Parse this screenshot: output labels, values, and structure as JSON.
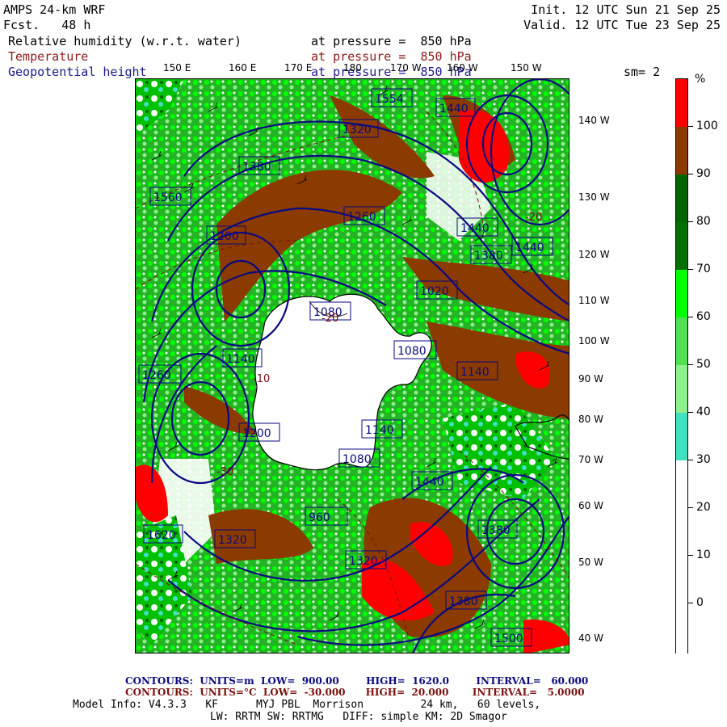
{
  "header": {
    "model": "AMPS 24-km WRF",
    "fcst": "Fcst.   48 h",
    "init": "Init. 12 UTC Sun 21 Sep 25",
    "valid": "Valid. 12 UTC Tue 23 Sep 25"
  },
  "fields": [
    {
      "name": "Relative humidity (w.r.t. water)",
      "pressure": "at pressure =  850 hPa",
      "color": "#000000"
    },
    {
      "name": "Temperature",
      "pressure": "at pressure =  850 hPa",
      "color": "#8b1a1a"
    },
    {
      "name": "Geopotential height",
      "pressure": "at pressure =  850 hPa",
      "color": "#1a1a8b"
    }
  ],
  "smoothing": "sm= 2",
  "top_lon_labels": [
    "150 E",
    "160 E",
    "170 E",
    "180",
    "170 W",
    "160 W",
    "150 W"
  ],
  "right_lon_labels": [
    "140 W",
    "130 W",
    "120 W",
    "110 W",
    "100 W",
    "90 W",
    "80 W",
    "70 W",
    "60 W",
    "50 W",
    "40 W"
  ],
  "colorbar": {
    "unit": "%",
    "labels": [
      "100",
      "90",
      "80",
      "70",
      "60",
      "50",
      "40",
      "30",
      "20",
      "10",
      "0"
    ],
    "colors": [
      "#ff0000",
      "#8b3a00",
      "#006400",
      "#00a000",
      "#00ff00",
      "#50e050",
      "#8cf08c",
      "#40e0c0",
      "#ffffff",
      "#ffffff",
      "#ffffff",
      "#ffffff"
    ]
  },
  "contour_values": [
    "1554",
    "1440",
    "1380",
    "1320",
    "1260",
    "1200",
    "1140",
    "1080",
    "1020",
    "960",
    "1500",
    "1560",
    "1620",
    "-20",
    "-10",
    "-30"
  ],
  "footer": {
    "line1": "CONTOURS:  UNITS=m  LOW=  900.00        HIGH=  1620.0        INTERVAL=   60.000",
    "line2": "CONTOURS:  UNITS=°C  LOW=  -30.000      HIGH=  20.000       INTERVAL=   5.0000",
    "line3": "Model Info: V4.3.3   KF      MYJ PBL  Morrison         24 km,   60 levels,",
    "line4": "LW: RRTM SW: RRTMG   DIFF: simple KM: 2D Smagor"
  },
  "colors": {
    "coast": "#000000",
    "height_contour": "#0a0a80",
    "temp_contour": "#7a1010",
    "ice": "#ffffff"
  }
}
